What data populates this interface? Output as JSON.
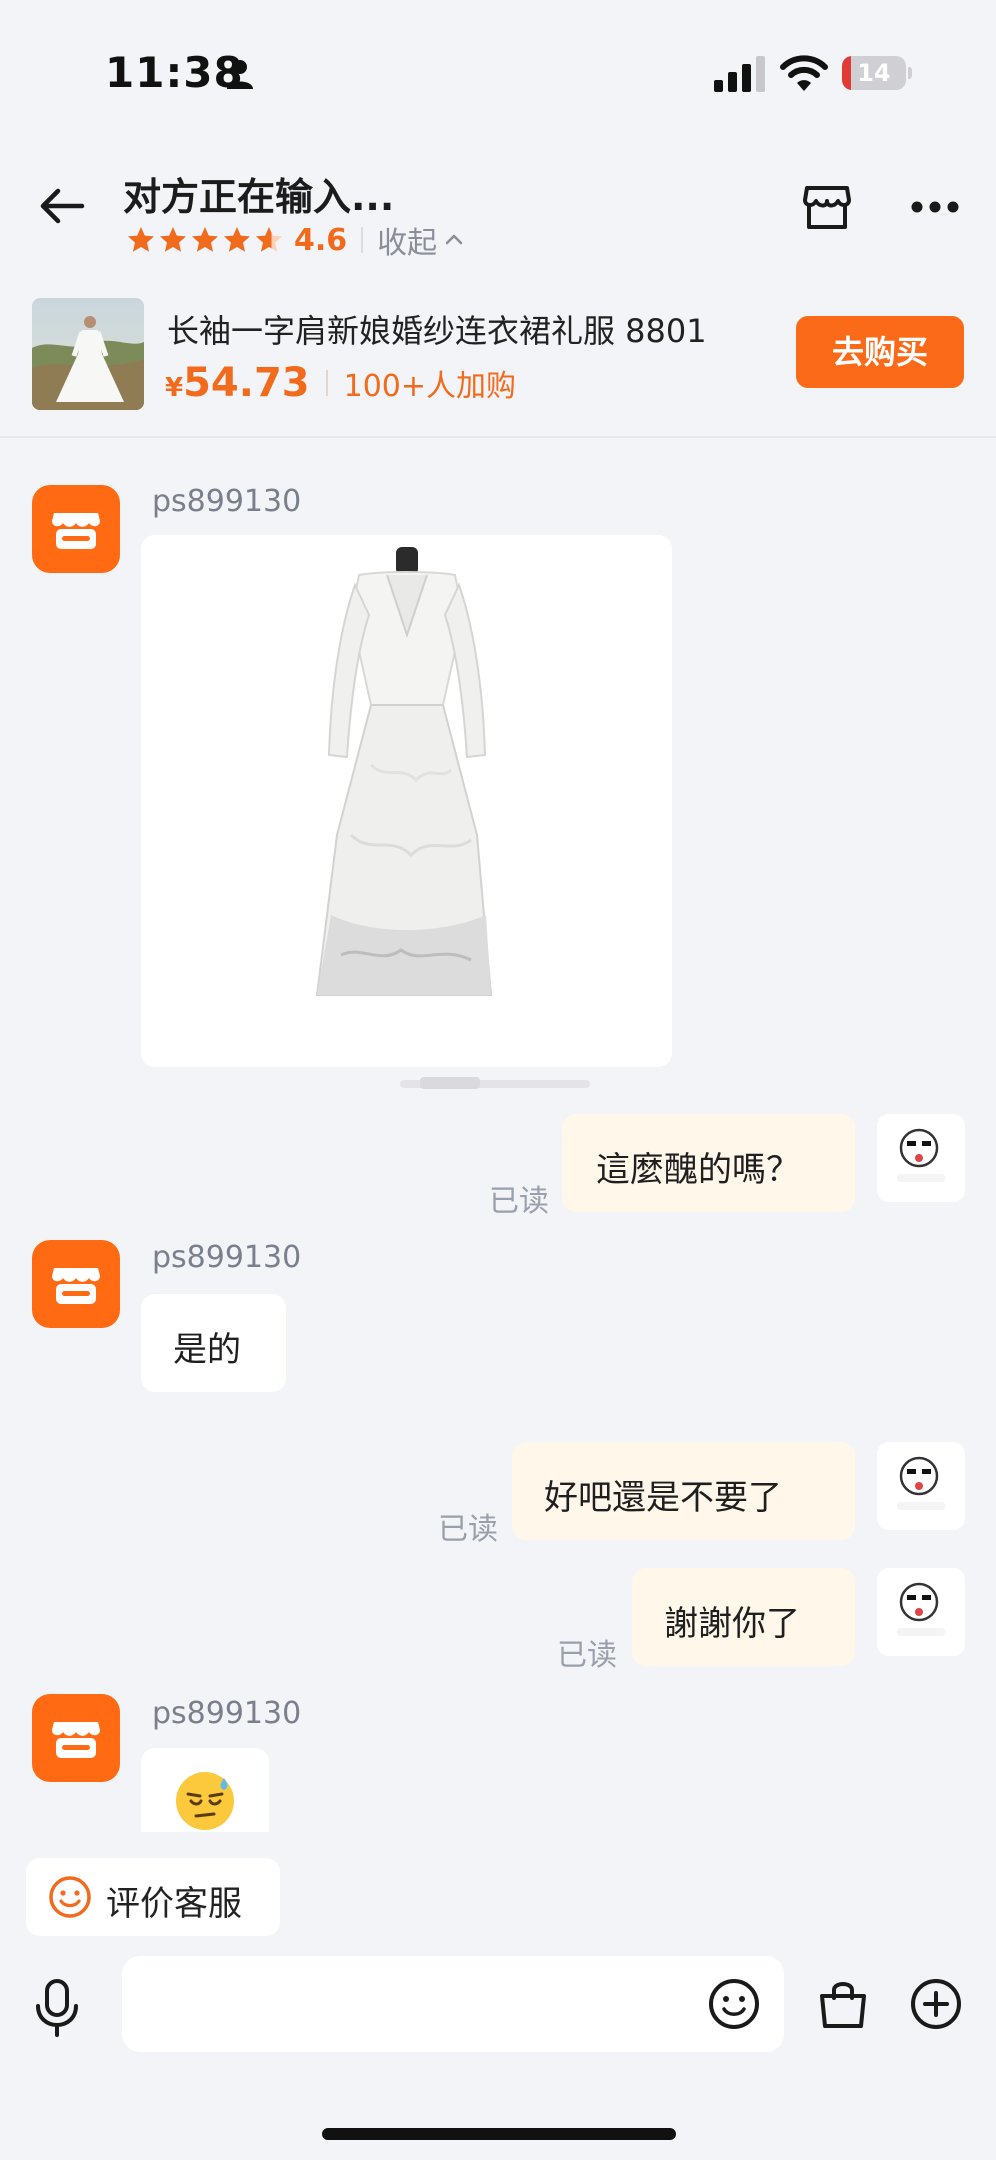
{
  "status_bar": {
    "time": "11:38",
    "battery": "14",
    "battery_level": 0.14
  },
  "header": {
    "title": "对方正在输入...",
    "rating": "4.6",
    "stars_filled": 4.6,
    "collapse_label": "收起"
  },
  "product": {
    "title": "长袖一字肩新娘婚纱连衣裙礼服 8801",
    "currency": "¥",
    "price": "54.73",
    "cart_count": "100+人加购",
    "buy_label": "去购买"
  },
  "messages": [
    {
      "from": "shop",
      "sender": "ps899130",
      "type": "image",
      "image_alt": "white lace wedding dress on mannequin"
    },
    {
      "from": "me",
      "text": "這麼醜的嗎？",
      "status": "已读"
    },
    {
      "from": "shop",
      "sender": "ps899130",
      "text": "是的"
    },
    {
      "from": "me",
      "text": "好吧還是不要了",
      "status": "已读"
    },
    {
      "from": "me",
      "text": "謝謝你了",
      "status": "已读"
    },
    {
      "from": "shop",
      "sender": "ps899130",
      "type": "emoji",
      "text": "😓"
    }
  ],
  "rate_service": {
    "label": "评价客服"
  },
  "input": {
    "placeholder": ""
  },
  "colors": {
    "accent": "#fb6a18",
    "price": "#f26a1b",
    "bubble_out": "#fff7ea",
    "background": "#f3f4f8"
  }
}
